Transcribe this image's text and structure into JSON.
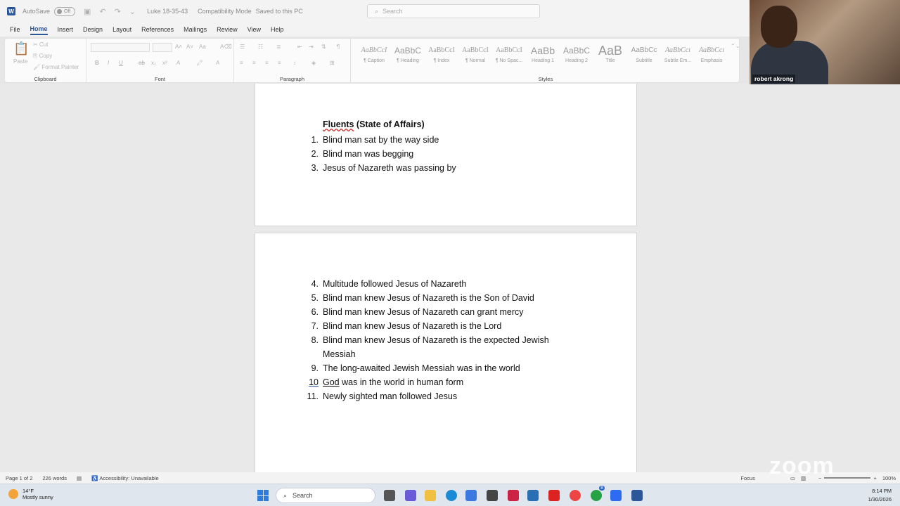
{
  "titlebar": {
    "autosave_label": "AutoSave",
    "autosave_state": "Off",
    "doc_title": "Luke 18-35-43",
    "compat_mode": "Compatibility Mode",
    "saved_status": "Saved to this PC",
    "search_placeholder": "Search"
  },
  "menu": {
    "tabs": [
      "File",
      "Home",
      "Insert",
      "Design",
      "Layout",
      "References",
      "Mailings",
      "Review",
      "View",
      "Help"
    ]
  },
  "ribbon": {
    "clipboard": {
      "label": "Clipboard",
      "paste": "Paste",
      "cut": "Cut",
      "copy": "Copy",
      "format_painter": "Format Painter"
    },
    "font": {
      "label": "Font"
    },
    "paragraph": {
      "label": "Paragraph"
    },
    "styles": {
      "label": "Styles",
      "items": [
        {
          "preview": "AaBbCcI",
          "name": "¶ Caption"
        },
        {
          "preview": "AaBbC",
          "name": "¶ Heading"
        },
        {
          "preview": "AaBbCcI",
          "name": "¶ Index"
        },
        {
          "preview": "AaBbCcI",
          "name": "¶ Normal"
        },
        {
          "preview": "AaBbCcI",
          "name": "¶ No Spac..."
        },
        {
          "preview": "AaBb",
          "name": "Heading 1"
        },
        {
          "preview": "AaBbC",
          "name": "Heading 2"
        },
        {
          "preview": "AaB",
          "name": "Title"
        },
        {
          "preview": "AaBbCc",
          "name": "Subtitle"
        },
        {
          "preview": "AaBbCcı",
          "name": "Subtle Em..."
        },
        {
          "preview": "AaBbCcı",
          "name": "Emphasis"
        }
      ]
    }
  },
  "document": {
    "heading_underlined": "Fluents",
    "heading_rest": " (State of Affairs)",
    "page1_items": [
      {
        "num": "1.",
        "text": "Blind man sat by the way side"
      },
      {
        "num": "2.",
        "text": "Blind man was begging"
      },
      {
        "num": "3.",
        "text": "Jesus of Nazareth was passing by"
      }
    ],
    "page2_items": [
      {
        "num": "4.",
        "text": "Multitude followed Jesus of Nazareth"
      },
      {
        "num": "5.",
        "text": "Blind man knew Jesus of Nazareth is the Son of David"
      },
      {
        "num": "6.",
        "text": "Blind man knew Jesus of Nazareth can grant mercy"
      },
      {
        "num": "7.",
        "text": "Blind man knew Jesus of Nazareth is the Lord"
      },
      {
        "num": "8.",
        "text": "Blind man knew Jesus of Nazareth is the expected Jewish Messiah"
      },
      {
        "num": "9.",
        "text": "The long-awaited Jewish Messiah was in the world"
      },
      {
        "num": "10",
        "word": "God",
        "text": " was in the world in human form"
      },
      {
        "num": "11.",
        "text": "Newly sighted man followed Jesus"
      }
    ]
  },
  "statusbar": {
    "page": "Page 1 of 2",
    "words": "226 words",
    "accessibility": "Accessibility: Unavailable",
    "focus": "Focus",
    "zoom": "100%"
  },
  "taskbar": {
    "temp": "14°F",
    "weather": "Mostly sunny",
    "search": "Search",
    "time": "8:14 PM",
    "date": "1/30/2026",
    "badge": "8"
  },
  "webcam": {
    "name": "robert akrong",
    "watermark": "zoom"
  }
}
